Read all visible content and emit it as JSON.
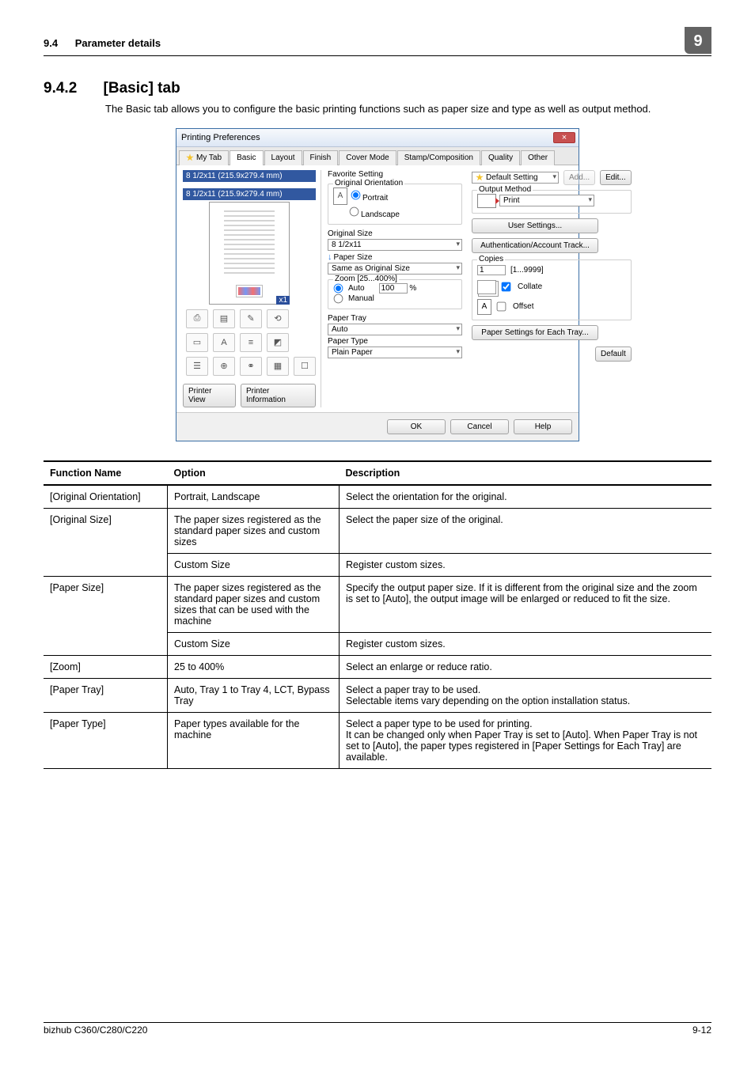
{
  "header": {
    "section_number": "9.4",
    "section_title": "Parameter details",
    "page_corner": "9"
  },
  "section": {
    "number": "9.4.2",
    "title": "[Basic] tab",
    "intro": "The Basic tab allows you to configure the basic printing functions such as paper size and type as well as output method."
  },
  "dialog": {
    "title": "Printing Preferences",
    "close": "×",
    "tabs": [
      "My Tab",
      "Basic",
      "Layout",
      "Finish",
      "Cover Mode",
      "Stamp/Composition",
      "Quality",
      "Other"
    ],
    "dim1": "8 1/2x11 (215.9x279.4 mm)",
    "dim2": "8 1/2x11 (215.9x279.4 mm)",
    "x1": "x1",
    "printer_view": "Printer View",
    "printer_info": "Printer Information",
    "fav_setting_lbl": "Favorite Setting",
    "default_setting": "Default Setting",
    "add": "Add...",
    "edit": "Edit...",
    "orig_orient": "Original Orientation",
    "portrait": "Portrait",
    "landscape": "Landscape",
    "A": "A",
    "orig_size_lbl": "Original Size",
    "orig_size_val": "8 1/2x11",
    "paper_size_lbl": "Paper Size",
    "paper_size_val": "Same as Original Size",
    "zoom_lbl": "Zoom [25...400%]",
    "zoom_auto": "Auto",
    "zoom_manual": "Manual",
    "zoom_val": "100",
    "zoom_pct": "%",
    "paper_tray_lbl": "Paper Tray",
    "paper_tray_val": "Auto",
    "paper_type_lbl": "Paper Type",
    "paper_type_val": "Plain Paper",
    "output_method_lbl": "Output Method",
    "output_method_val": "Print",
    "user_settings": "User Settings...",
    "auth_track": "Authentication/Account Track...",
    "copies_lbl": "Copies",
    "copies_val": "1",
    "copies_range": "[1...9999]",
    "collate": "Collate",
    "offset": "Offset",
    "paper_settings_each_tray": "Paper Settings for Each Tray...",
    "default_btn": "Default",
    "ok": "OK",
    "cancel": "Cancel",
    "help": "Help"
  },
  "table": {
    "head": [
      "Function Name",
      "Option",
      "Description"
    ],
    "rows": [
      {
        "fn": "[Original Orientation]",
        "opt": "Portrait, Landscape",
        "desc": "Select the orientation for the original."
      },
      {
        "fn": "[Original Size]",
        "opt": "The paper sizes registered as the standard paper sizes and custom sizes",
        "desc": "Select the paper size of the original."
      },
      {
        "fn": "",
        "opt": "Custom Size",
        "desc": "Register custom sizes."
      },
      {
        "fn": "[Paper Size]",
        "opt": "The paper sizes registered as the standard paper sizes and custom sizes that can be used with the machine",
        "desc": "Specify the output paper size. If it is different from the original size and the zoom is set to [Auto], the output image will be enlarged or reduced to fit the size."
      },
      {
        "fn": "",
        "opt": "Custom Size",
        "desc": "Register custom sizes."
      },
      {
        "fn": "[Zoom]",
        "opt": "25 to 400%",
        "desc": "Select an enlarge or reduce ratio."
      },
      {
        "fn": "[Paper Tray]",
        "opt": "Auto, Tray 1 to Tray 4, LCT, Bypass Tray",
        "desc": "Select a paper tray to be used.\nSelectable items vary depending on the option installation status."
      },
      {
        "fn": "[Paper Type]",
        "opt": "Paper types available for the machine",
        "desc": "Select a paper type to be used for printing.\nIt can be changed only when Paper Tray is set to [Auto]. When Paper Tray is not set to [Auto], the paper types registered in [Paper Settings for Each Tray] are available."
      }
    ]
  },
  "footer": {
    "model": "bizhub C360/C280/C220",
    "page": "9-12"
  }
}
